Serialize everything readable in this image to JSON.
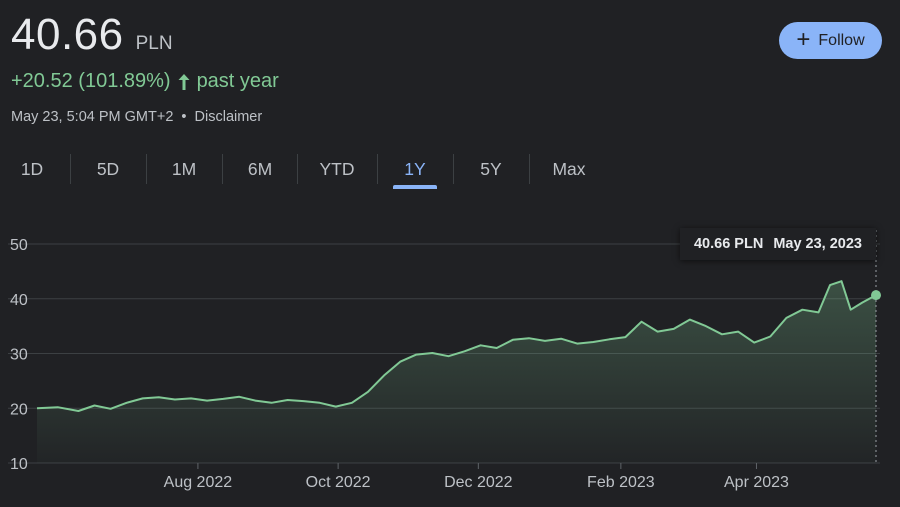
{
  "quote": {
    "price": "40.66",
    "currency": "PLN",
    "change_text": "+20.52 (101.89%)",
    "change_period": "past year",
    "timestamp": "May 23, 5:04 PM GMT+2",
    "separator": "•",
    "disclaimer_label": "Disclaimer"
  },
  "follow_button": {
    "label": "Follow",
    "icon": "plus-icon"
  },
  "tabs": [
    {
      "label": "1D"
    },
    {
      "label": "5D"
    },
    {
      "label": "1M"
    },
    {
      "label": "6M"
    },
    {
      "label": "YTD"
    },
    {
      "label": "1Y",
      "active": true
    },
    {
      "label": "5Y"
    },
    {
      "label": "Max"
    }
  ],
  "tooltip": {
    "value": "40.66 PLN",
    "date": "May 23, 2023"
  },
  "colors": {
    "background": "#202124",
    "line": "#81c995",
    "accent": "#8ab4f8",
    "grid": "#3c4043"
  },
  "chart_data": {
    "type": "area",
    "ylim": [
      10,
      50
    ],
    "yticks": [
      "10",
      "20",
      "30",
      "40",
      "50"
    ],
    "x_range": [
      "2022-05-23",
      "2023-05-23"
    ],
    "xticks": [
      {
        "date": "2022-08-01",
        "label": "Aug 2022"
      },
      {
        "date": "2022-10-01",
        "label": "Oct 2022"
      },
      {
        "date": "2022-12-01",
        "label": "Dec 2022"
      },
      {
        "date": "2023-02-01",
        "label": "Feb 2023"
      },
      {
        "date": "2023-04-01",
        "label": "Apr 2023"
      }
    ],
    "grid": true,
    "series": [
      {
        "x": [
          "2022-05-23",
          "2022-06-01",
          "2022-06-10",
          "2022-06-17",
          "2022-06-24",
          "2022-07-01",
          "2022-07-08",
          "2022-07-15",
          "2022-07-22",
          "2022-07-29",
          "2022-08-05",
          "2022-08-12",
          "2022-08-19",
          "2022-08-26",
          "2022-09-02",
          "2022-09-09",
          "2022-09-16",
          "2022-09-23",
          "2022-09-30",
          "2022-10-07",
          "2022-10-14",
          "2022-10-21",
          "2022-10-28",
          "2022-11-04",
          "2022-11-11",
          "2022-11-18",
          "2022-11-25",
          "2022-12-02",
          "2022-12-09",
          "2022-12-16",
          "2022-12-23",
          "2022-12-30",
          "2023-01-06",
          "2023-01-13",
          "2023-01-20",
          "2023-01-27",
          "2023-02-03",
          "2023-02-10",
          "2023-02-17",
          "2023-02-24",
          "2023-03-03",
          "2023-03-10",
          "2023-03-17",
          "2023-03-24",
          "2023-03-31",
          "2023-04-07",
          "2023-04-14",
          "2023-04-21",
          "2023-04-28",
          "2023-05-03",
          "2023-05-08",
          "2023-05-12",
          "2023-05-17",
          "2023-05-23"
        ],
        "values": [
          20.0,
          20.2,
          19.5,
          20.5,
          19.9,
          21.0,
          21.8,
          22.0,
          21.6,
          21.8,
          21.4,
          21.7,
          22.1,
          21.4,
          21.0,
          21.5,
          21.3,
          21.0,
          20.3,
          21.0,
          23.0,
          26.0,
          28.5,
          29.8,
          30.1,
          29.5,
          30.4,
          31.5,
          31.0,
          32.5,
          32.8,
          32.3,
          32.7,
          31.8,
          32.1,
          32.6,
          33.0,
          35.8,
          34.0,
          34.5,
          36.2,
          35.0,
          33.5,
          34.0,
          32.0,
          33.1,
          36.5,
          38.0,
          37.5,
          42.5,
          43.2,
          38.0,
          39.3,
          40.66
        ]
      }
    ]
  }
}
